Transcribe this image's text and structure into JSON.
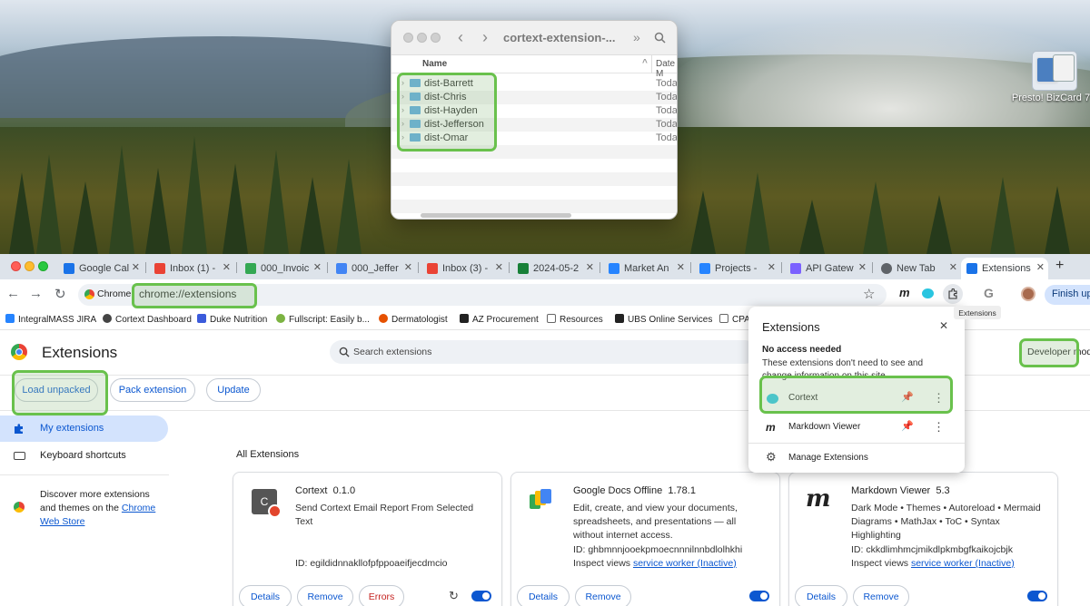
{
  "desktop": {
    "icon_label": "Presto! BizCard 7"
  },
  "finder": {
    "title": "cortext-extension-...",
    "col_name": "Name",
    "col_date": "Date M",
    "rows": [
      {
        "name": "dist-Barrett",
        "date": "Today"
      },
      {
        "name": "dist-Chris",
        "date": "Today"
      },
      {
        "name": "dist-Hayden",
        "date": "Today"
      },
      {
        "name": "dist-Jefferson",
        "date": "Today"
      },
      {
        "name": "dist-Omar",
        "date": "Today"
      }
    ]
  },
  "tabs": [
    {
      "label": "Google Cal",
      "color": "#1a73e8"
    },
    {
      "label": "Inbox (1) -",
      "color": "#ea4335"
    },
    {
      "label": "000_Invoic",
      "color": "#34a853"
    },
    {
      "label": "000_Jeffer",
      "color": "#4285f4"
    },
    {
      "label": "Inbox (3) -",
      "color": "#ea4335"
    },
    {
      "label": "2024-05-2",
      "color": "#188038"
    },
    {
      "label": "Market An",
      "color": "#2684ff"
    },
    {
      "label": "Projects -",
      "color": "#2684ff"
    },
    {
      "label": "API Gatew",
      "color": "#7b61ff"
    },
    {
      "label": "New Tab",
      "color": "#5f6368"
    },
    {
      "label": "Extensions",
      "color": "#1a73e8"
    }
  ],
  "address": {
    "chip": "Chrome",
    "url": "chrome://extensions",
    "finish": "Finish up"
  },
  "bookmarks": [
    {
      "label": "IntegralMASS JIRA",
      "color": "#2684ff"
    },
    {
      "label": "Cortext Dashboard",
      "color": "#444"
    },
    {
      "label": "Duke Nutrition",
      "color": "#3b5bdb"
    },
    {
      "label": "Fullscript: Easily b...",
      "color": "#7cb342"
    },
    {
      "label": "Dermatologist",
      "color": "#e65100"
    },
    {
      "label": "AZ Procurement",
      "color": "#222"
    },
    {
      "label": "Resources",
      "color": "#666"
    },
    {
      "label": "UBS Online Services",
      "color": "#222"
    },
    {
      "label": "CPA",
      "color": "#666"
    }
  ],
  "extensions_page": {
    "title": "Extensions",
    "search_placeholder": "Search extensions",
    "load_unpacked": "Load unpacked",
    "pack_extension": "Pack extension",
    "update": "Update",
    "developer_mode": "Developer mode",
    "nav_my_extensions": "My extensions",
    "nav_keyboard": "Keyboard shortcuts",
    "discover_pre": "Discover more extensions and themes on the ",
    "discover_link": "Chrome Web Store",
    "all_extensions": "All Extensions"
  },
  "cards": [
    {
      "name": "Cortext",
      "version": "0.1.0",
      "desc": "Send Cortext Email Report From Selected Text",
      "id": "ID: egildidnnakllofpfppoaeifjecdmcio",
      "inspect_pre": "",
      "inspect_link": "",
      "details": "Details",
      "remove": "Remove",
      "errors": "Errors"
    },
    {
      "name": "Google Docs Offline",
      "version": "1.78.1",
      "desc": "Edit, create, and view your documents, spreadsheets, and presentations — all without internet access.",
      "id": "ID: ghbmnnjooekpmoecnnnilnnbdlolhkhi",
      "inspect_pre": "Inspect views ",
      "inspect_link": "service worker (Inactive)",
      "details": "Details",
      "remove": "Remove"
    },
    {
      "name": "Markdown Viewer",
      "version": "5.3",
      "desc": "Dark Mode • Themes • Autoreload • Mermaid Diagrams • MathJax • ToC • Syntax Highlighting",
      "id": "ID: ckkdlimhmcjmikdlpkmbgfkaikojcbjk",
      "inspect_pre": "Inspect views ",
      "inspect_link": "service worker (Inactive)",
      "details": "Details",
      "remove": "Remove"
    }
  ],
  "popup": {
    "title": "Extensions",
    "tooltip": "Extensions",
    "section": "No access needed",
    "section_desc": "These extensions don't need to see and change information on this site.",
    "items": [
      {
        "name": "Cortext"
      },
      {
        "name": "Markdown Viewer"
      }
    ],
    "manage": "Manage Extensions"
  },
  "colors": {
    "accent": "#0b57d0",
    "highlight": "#69c14c"
  }
}
